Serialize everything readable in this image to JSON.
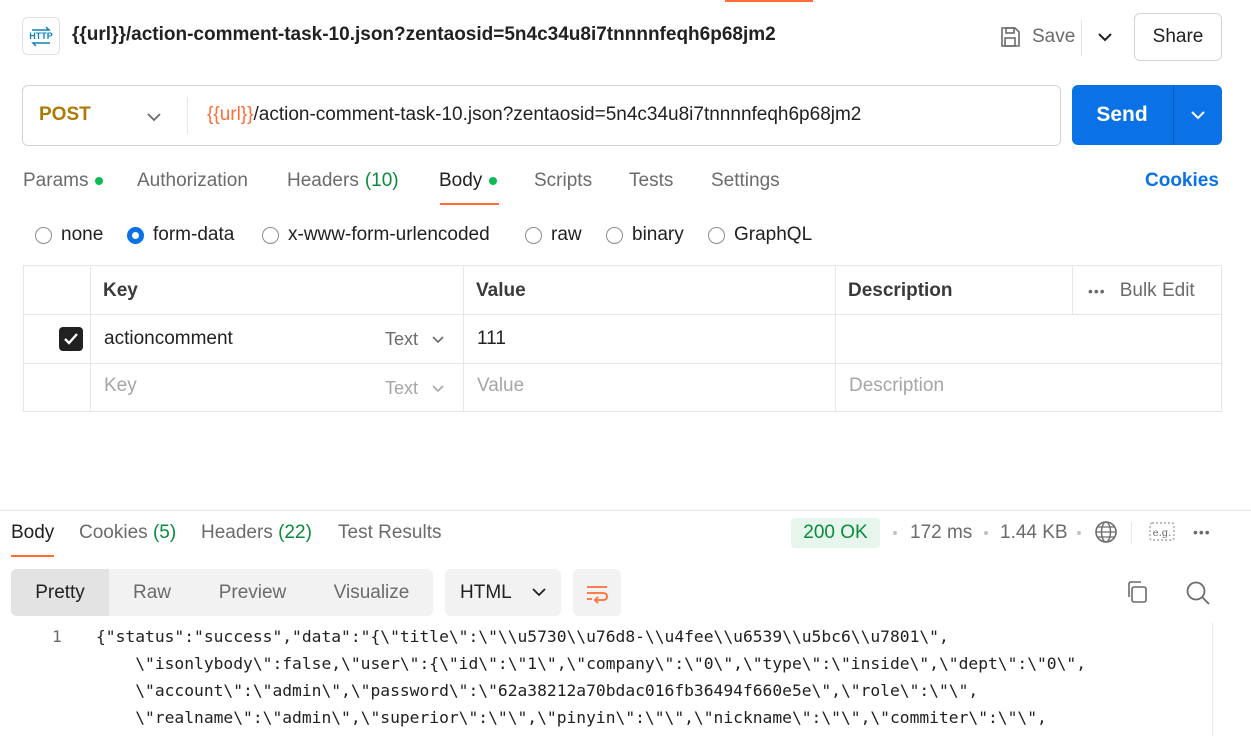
{
  "header": {
    "title": "{{url}}/action-comment-task-10.json?zentaosid=5n4c34u8i7tnnnnfeqh6p68jm2",
    "save_label": "Save",
    "share_label": "Share"
  },
  "request": {
    "method": "POST",
    "url_var": "{{url}}",
    "url_rest": "/action-comment-task-10.json?zentaosid=5n4c34u8i7tnnnnfeqh6p68jm2",
    "send_label": "Send"
  },
  "tabs": {
    "params": "Params",
    "authorization": "Authorization",
    "headers": "Headers",
    "headers_count": "(10)",
    "body": "Body",
    "scripts": "Scripts",
    "tests": "Tests",
    "settings": "Settings",
    "cookies": "Cookies"
  },
  "body_types": [
    "none",
    "form-data",
    "x-www-form-urlencoded",
    "raw",
    "binary",
    "GraphQL"
  ],
  "body_type_selected": "form-data",
  "table": {
    "headers": {
      "key": "Key",
      "value": "Value",
      "description": "Description",
      "bulk_edit": "Bulk Edit"
    },
    "rows": [
      {
        "checked": true,
        "key": "actioncomment",
        "type": "Text",
        "value": "111",
        "description": ""
      }
    ],
    "placeholder": {
      "key": "Key",
      "type": "Text",
      "value": "Value",
      "description": "Description"
    }
  },
  "response": {
    "tabs": {
      "body": "Body",
      "cookies": "Cookies",
      "cookies_count": "(5)",
      "headers": "Headers",
      "headers_count": "(22)",
      "test_results": "Test Results"
    },
    "status": "200 OK",
    "time": "172 ms",
    "size": "1.44 KB",
    "views": [
      "Pretty",
      "Raw",
      "Preview",
      "Visualize"
    ],
    "active_view": "Pretty",
    "format": "HTML",
    "line_number": "1",
    "code_lines": [
      "{\"status\":\"success\",\"data\":\"{\\\"title\\\":\\\"\\\\u5730\\\\u76d8-\\\\u4fee\\\\u6539\\\\u5bc6\\\\u7801\\\",",
      "    \\\"isonlybody\\\":false,\\\"user\\\":{\\\"id\\\":\\\"1\\\",\\\"company\\\":\\\"0\\\",\\\"type\\\":\\\"inside\\\",\\\"dept\\\":\\\"0\\\",",
      "    \\\"account\\\":\\\"admin\\\",\\\"password\\\":\\\"62a38212a70bdac016fb36494f660e5e\\\",\\\"role\\\":\\\"\\\",",
      "    \\\"realname\\\":\\\"admin\\\",\\\"superior\\\":\\\"\\\",\\\"pinyin\\\":\\\"\\\",\\\"nickname\\\":\\\"\\\",\\\"commiter\\\":\\\"\\\","
    ]
  },
  "colors": {
    "accent": "#ff6c37",
    "primary": "#0a72e6",
    "method": "#ad7a03",
    "success": "#0b8a3e"
  }
}
